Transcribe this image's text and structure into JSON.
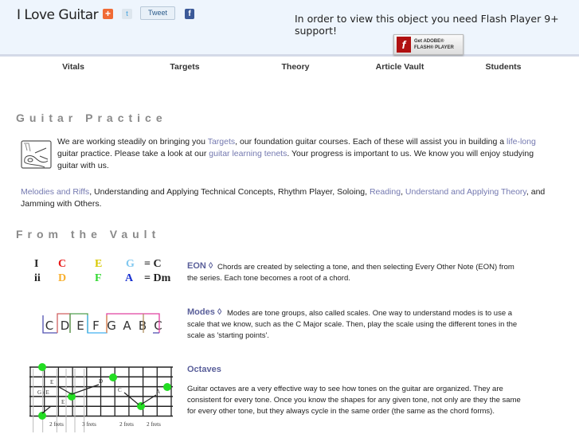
{
  "header": {
    "logo": "I Love Guitar",
    "tweet_label": "Tweet",
    "flash_message": "In order to view this object you need Flash Player 9+ support!",
    "get_flash": {
      "line1": "Get ADOBE®",
      "line2": "FLASH® PLAYER"
    }
  },
  "nav": [
    {
      "label": "Vitals"
    },
    {
      "label": "Targets"
    },
    {
      "label": "Theory"
    },
    {
      "label": "Article Vault"
    },
    {
      "label": "Students"
    }
  ],
  "practice": {
    "heading": "Guitar Practice",
    "p1": {
      "t1": "We are working steadily on bringing you ",
      "l1": "Targets",
      "t2": ", our foundation guitar courses. Each of these will assist you in building a ",
      "l2": "life-long",
      "t3": " guitar practice. Please take a look at our ",
      "l3": "guitar learning tenets",
      "t4": ". Your progress is important to us. We know you will enjoy studying guitar with us."
    },
    "p2": {
      "l1": "Melodies and Riffs",
      "t1": ", Understanding and Applying Technical Concepts, Rhythm Player, Soloing, ",
      "l2": "Reading",
      "t2": ", ",
      "l3": "Understand and Applying Theory",
      "t3": ", and Jamming with Others."
    }
  },
  "vault": {
    "heading": "From the Vault",
    "chord_table": {
      "rows": [
        {
          "numeral": "I",
          "notes": [
            "C",
            "E",
            "G"
          ],
          "result": "= C"
        },
        {
          "numeral": "ii",
          "notes": [
            "D",
            "F",
            "A"
          ],
          "result": "= Dm"
        }
      ],
      "note_colors": [
        "#e81818",
        "#d8c800",
        "#80c8f0",
        "#f8b030",
        "#30d830",
        "#1830d0"
      ]
    },
    "modes_notes": [
      "C",
      "D",
      "E",
      "F",
      "G",
      "A",
      "B",
      "C"
    ],
    "fret_labels": [
      "2 frets",
      "3 frets",
      "2 frets",
      "2 frets"
    ],
    "fret_note_labels": [
      "G / E",
      "E",
      "E",
      "D",
      "C",
      "A"
    ],
    "items": [
      {
        "title": "EON",
        "sep": " ◊ ",
        "text": "Chords are created by selecting a tone, and then selecting Every Other Note (EON) from the series. Each tone becomes a root of a chord."
      },
      {
        "title": "Modes",
        "sep": " ◊ ",
        "text": "Modes are tone groups, also called scales. One way to understand modes is to use a scale that we know, such as the C Major scale. Then, play the scale using the different tones in the scale as 'starting points'."
      },
      {
        "title": "Octaves",
        "text": "Guitar octaves are a very effective way to see how tones on the guitar are organized. They are consistent for every tone. Once you know the shapes for any given tone, not only are they the same for every other tone, but they always cycle in the same order (the same as the chord forms)."
      }
    ]
  }
}
